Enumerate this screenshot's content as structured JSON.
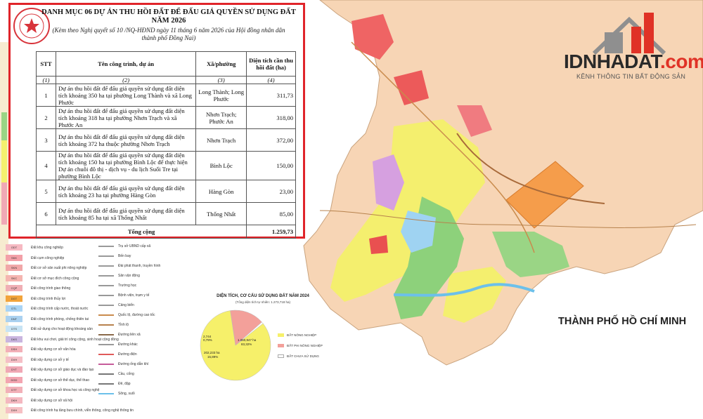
{
  "document": {
    "title_line1": "DANH MỤC 06 DỰ ÁN THU HỒI ĐẤT ĐỂ ĐẤU GIÁ QUYỀN SỬ DỤNG ĐẤT",
    "title_line2": "NĂM 2026",
    "subtitle_line1": "(Kèm theo Nghị quyết số 10 /NQ-HĐND ngày 11 tháng 6 năm 2026 của Hội đồng nhân dân",
    "subtitle_line2": "thành phố Đồng Nai)",
    "columns": [
      "STT",
      "Tên công trình, dự án",
      "Xã/phường",
      "Diện tích cần thu hồi đất (ha)"
    ],
    "column_numbers": [
      "(1)",
      "(2)",
      "(3)",
      "(4)"
    ],
    "rows": [
      {
        "stt": "1",
        "name": "Dự án thu hồi đất để đấu giá quyền sử dụng đất diện tích khoảng 350 ha tại phường Long Thành và xã Long Phước",
        "ward": "Long Thành; Long Phước",
        "area": "311,73"
      },
      {
        "stt": "2",
        "name": "Dự án thu hồi đất để đấu giá quyền sử dụng đất diện tích khoảng 318 ha tại phường Nhơn Trạch và xã Phước An",
        "ward": "Nhơn Trạch; Phước An",
        "area": "318,00"
      },
      {
        "stt": "3",
        "name": "Dự án thu hồi đất để đấu giá quyền sử dụng đất diện tích khoảng 372 ha thuộc phường Nhơn Trạch",
        "ward": "Nhơn Trạch",
        "area": "372,00"
      },
      {
        "stt": "4",
        "name": "Dự án thu hồi đất để đấu giá quyền sử dụng đất diện tích khoảng 150 ha tại phường Bình Lộc để thực hiện Dự án chuỗi đô thị - dịch vụ - du lịch Suối Tre tại phường Bình Lộc",
        "ward": "Bình Lộc",
        "area": "150,00"
      },
      {
        "stt": "5",
        "name": "Dự án thu hồi đất để đấu giá quyền sử dụng đất diện tích khoảng 23 ha tại phường Hàng Gòn",
        "ward": "Hàng Gòn",
        "area": "23,00"
      },
      {
        "stt": "6",
        "name": "Dự án thu hồi đất để đấu giá quyền sử dụng đất diện tích khoảng 85 ha tại xã Thống Nhất",
        "ward": "Thống Nhất",
        "area": "85,00"
      }
    ],
    "total_label": "Tổng cộng",
    "total_area": "1.259,73"
  },
  "logo": {
    "brand_main": "IDNHADAT",
    "brand_suffix": ".com",
    "tagline": "KÊNH THÔNG TIN BẤT ĐỘNG SẢN"
  },
  "map": {
    "city_label": "THÀNH PHỐ HỒ CHÍ MINH"
  },
  "legend": {
    "chips": [
      "ODT",
      "SKK",
      "SKN",
      "SKC",
      "CQP",
      "DGT",
      "DTL",
      "DNT",
      "DTS",
      "DKS",
      "DSH",
      "DVH",
      "DYT",
      "DGD",
      "DTT",
      "DKH",
      "DXH"
    ],
    "chip_colors": [
      "#f6b9c2",
      "#f3a0a8",
      "#f1a7a8",
      "#f5b5b0",
      "#f0aeb4",
      "#f2a43b",
      "#a9d4f5",
      "#aad1f0",
      "#c7e3f4",
      "#c9b5df",
      "#f3b0b8",
      "#f5bfc6",
      "#f0a8b5",
      "#f3a5b1",
      "#f2b0b8",
      "#f4b8c0",
      "#f6c0c4"
    ],
    "items": [
      "Đất khu công nghiệp",
      "Đất cụm công nghiệp",
      "Đất cơ sở sản xuất phi nông nghiệp",
      "Đất cơ sở mục đích công cộng",
      "Đất công trình giao thông",
      "Đất công trình thủy lợi",
      "Đất công trình cấp nước, thoát nước",
      "Đất công trình phòng, chống thiên tai",
      "Đất sử dụng cho hoạt động khoáng sản",
      "Đất khu vui chơi, giải trí công cộng, sinh hoạt cộng đồng",
      "Đất xây dựng cơ sở văn hóa",
      "Đất xây dựng cơ sở y tế",
      "Đất xây dựng cơ sở giáo dục và đào tạo",
      "Đất xây dựng cơ sở thể dục, thể thao",
      "Đất xây dựng cơ sở khoa học và công nghệ",
      "Đất xây dựng cơ sở xã hội",
      "Đất công trình hạ tầng bưu chính, viễn thông, công nghệ thông tin"
    ],
    "symbols": [
      "Trụ sở UBND cấp xã",
      "Bến bay",
      "Đài phát thanh, truyền hình",
      "Sân vận động",
      "Trường học",
      "Bệnh viện, trạm y tế",
      "Cảng biển",
      "Quốc lộ, đường cao tốc",
      "Tỉnh lộ",
      "Đường liên xã",
      "Đường khác",
      "Đường điện",
      "Đường ống dẫn khí",
      "Cầu, cống",
      "Đê, đập",
      "Sông, suối"
    ]
  },
  "chart_data": {
    "type": "pie",
    "title": "DIỆN TÍCH, CƠ CẤU SỬ DỤNG ĐẤT NĂM 2024",
    "subtitle": "(Tổng diện tích tự nhiên: 1.273,718 ha)",
    "series": [
      {
        "name": "ĐẤT NÔNG NGHIỆP",
        "value": 1060.947,
        "label": "1.060,947 ha",
        "percent": "83,32%",
        "color": "#f6f06a"
      },
      {
        "name": "ĐẤT PHI NÔNG NGHIỆP",
        "value": 202.233,
        "label": "202,233 ha",
        "percent": "15,89%",
        "color": "#f3a09a"
      },
      {
        "name": "ĐẤT CHƯA SỬ DỤNG",
        "value": 10.538,
        "label": "2,744",
        "percent": "0,79%",
        "color": "#ffffff"
      }
    ]
  }
}
